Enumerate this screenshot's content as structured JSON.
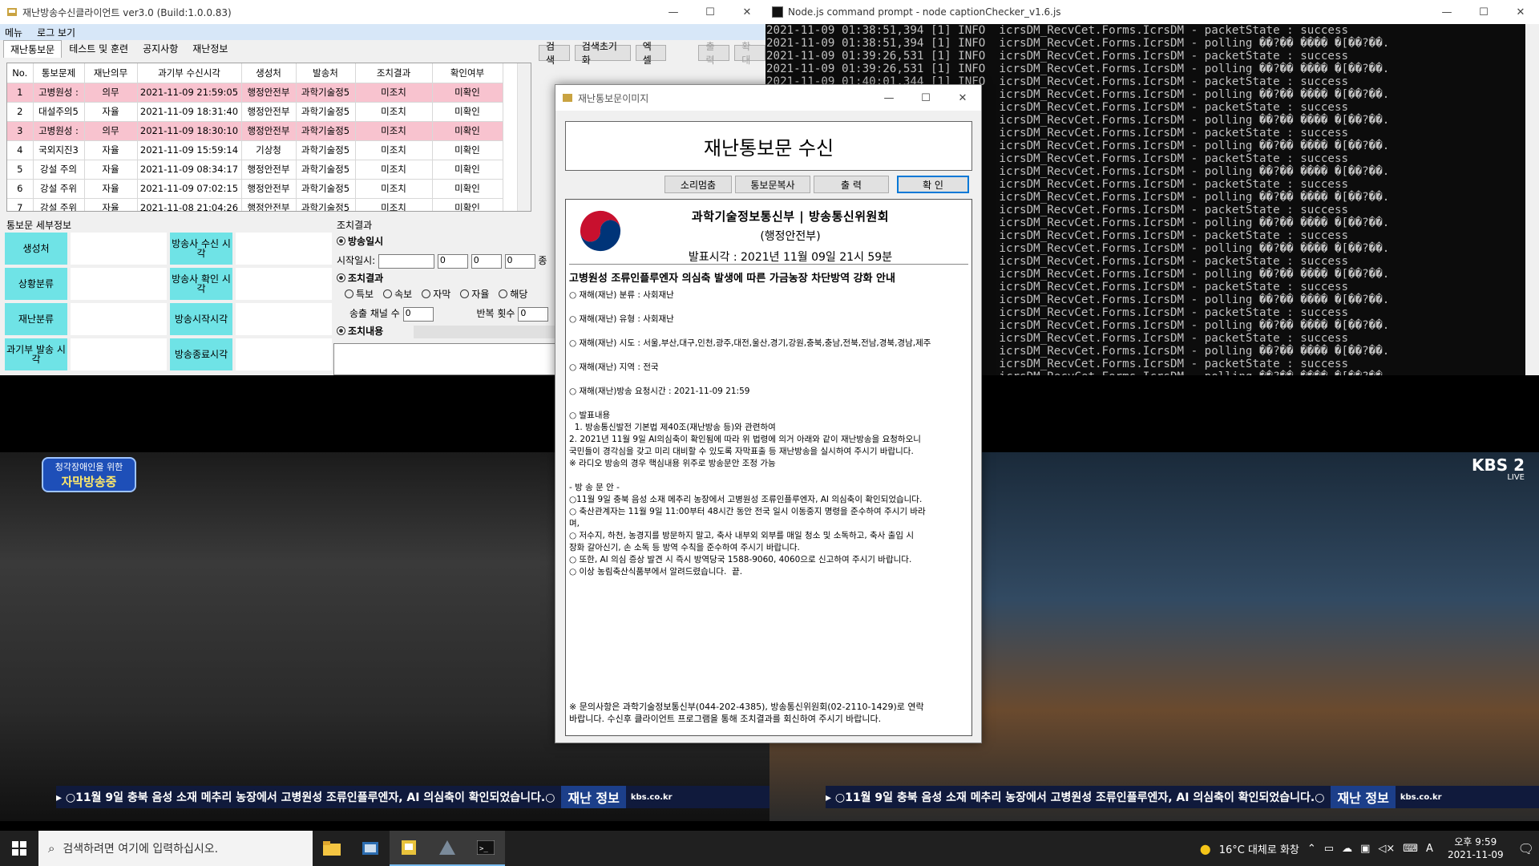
{
  "client": {
    "title": "재난방송수신클라이언트 ver3.0 (Build:1.0.0.83)",
    "menu": [
      "메뉴",
      "로그 보기"
    ],
    "tabs": [
      "재난통보문",
      "테스트 및 훈련",
      "공지사항",
      "재난정보"
    ],
    "buttons": {
      "search": "검색",
      "reset": "검색초기화",
      "excel": "엑셀",
      "print": "출력",
      "zoom": "확대"
    },
    "grid": {
      "headers": [
        "No.",
        "통보문제",
        "재난의무",
        "과기부 수신시각",
        "생성처",
        "발송처",
        "조치결과",
        "확인여부"
      ],
      "rows": [
        [
          "1",
          "고병원성 :",
          "의무",
          "2021-11-09 21:59:05",
          "행정안전부",
          "과학기술정5",
          "미조치",
          "미확인"
        ],
        [
          "2",
          "대설주의5",
          "자율",
          "2021-11-09 18:31:40",
          "행정안전부",
          "과학기술정5",
          "미조치",
          "미확인"
        ],
        [
          "3",
          "고병원성 :",
          "의무",
          "2021-11-09 18:30:10",
          "행정안전부",
          "과학기술정5",
          "미조치",
          "미확인"
        ],
        [
          "4",
          "국외지진3",
          "자율",
          "2021-11-09 15:59:14",
          "기상청",
          "과학기술정5",
          "미조치",
          "미확인"
        ],
        [
          "5",
          "강설 주의",
          "자율",
          "2021-11-09 08:34:17",
          "행정안전부",
          "과학기술정5",
          "미조치",
          "미확인"
        ],
        [
          "6",
          "강설 주위",
          "자율",
          "2021-11-09 07:02:15",
          "행정안전부",
          "과학기술정5",
          "미조치",
          "미확인"
        ],
        [
          "7",
          "강설 주위",
          "자율",
          "2021-11-08 21:04:26",
          "행정안전부",
          "과학기술정5",
          "미조치",
          "미확인"
        ]
      ]
    },
    "detail": {
      "section": "통보문 세부정보",
      "labels": [
        "생성처",
        "상황분류",
        "재난분류",
        "과기부 발송 시각",
        "방송사 수신 시각",
        "방송사 확인 시각",
        "방송시작시각",
        "방송종료시각"
      ]
    },
    "action": {
      "section": "조치결과",
      "broadcast_time": "방송일시",
      "start_label": "시작일시:",
      "spin_values": [
        "0",
        "0",
        "0"
      ],
      "tail": "종",
      "result_label": "조치결과",
      "radios": [
        "특보",
        "속보",
        "자막",
        "자율",
        "해당"
      ],
      "channels_label": "송출 채널 수",
      "channels_value": "0",
      "repeat_label": "반복 횟수",
      "repeat_value": "0",
      "content_label": "조치내용"
    }
  },
  "console": {
    "title": "Node.js command prompt - node  captionChecker_v1.6.js",
    "lines": [
      "2021-11-09 01:38:51,394 [1] INFO  icrsDM_RecvCet.Forms.IcrsDM - packetState : success",
      "2021-11-09 01:38:51,394 [1] INFO  icrsDM_RecvCet.Forms.IcrsDM - polling ��?�� ���� �[��?��.",
      "2021-11-09 01:39:26,531 [1] INFO  icrsDM_RecvCet.Forms.IcrsDM - packetState : success",
      "2021-11-09 01:39:26,531 [1] INFO  icrsDM_RecvCet.Forms.IcrsDM - polling ��?�� ���� �[��?��.",
      "2021-11-09 01:40:01,344 [1] INFO  icrsDM_RecvCet.Forms.IcrsDM - packetState : success",
      "                                  icrsDM_RecvCet.Forms.IcrsDM - polling ��?�� ���� �[��?��.",
      "                                  icrsDM_RecvCet.Forms.IcrsDM - packetState : success",
      "                                  icrsDM_RecvCet.Forms.IcrsDM - polling ��?�� ���� �[��?��.",
      "                                  icrsDM_RecvCet.Forms.IcrsDM - packetState : success",
      "                                  icrsDM_RecvCet.Forms.IcrsDM - polling ��?�� ���� �[��?��.",
      "                                  icrsDM_RecvCet.Forms.IcrsDM - packetState : success",
      "                                  icrsDM_RecvCet.Forms.IcrsDM - polling ��?�� ���� �[��?��.",
      "                                  icrsDM_RecvCet.Forms.IcrsDM - packetState : success",
      "                                  icrsDM_RecvCet.Forms.IcrsDM - polling ��?�� ���� �[��?��.",
      "                                  icrsDM_RecvCet.Forms.IcrsDM - packetState : success",
      "                                  icrsDM_RecvCet.Forms.IcrsDM - polling ��?�� ���� �[��?��.",
      "                                  icrsDM_RecvCet.Forms.IcrsDM - packetState : success",
      "                                  icrsDM_RecvCet.Forms.IcrsDM - polling ��?�� ���� �[��?��.",
      "                                  icrsDM_RecvCet.Forms.IcrsDM - packetState : success",
      "                                  icrsDM_RecvCet.Forms.IcrsDM - polling ��?�� ���� �[��?��.",
      "                                  icrsDM_RecvCet.Forms.IcrsDM - packetState : success",
      "                                  icrsDM_RecvCet.Forms.IcrsDM - polling ��?�� ���� �[��?��.",
      "                                  icrsDM_RecvCet.Forms.IcrsDM - packetState : success",
      "                                  icrsDM_RecvCet.Forms.IcrsDM - polling ��?�� ���� �[��?��.",
      "                                  icrsDM_RecvCet.Forms.IcrsDM - packetState : success",
      "                                  icrsDM_RecvCet.Forms.IcrsDM - polling ��?�� ���� �[��?��.",
      "                                  icrsDM_RecvCet.Forms.IcrsDM - packetState : success",
      "                                  icrsDM_RecvCet.Forms.IcrsDM - polling ��?�� ���� �[��?��."
    ]
  },
  "tv": {
    "left_badge_line1": "청각장애인을 위한",
    "left_badge_line2": "자막방송중",
    "ticker": "▸ ○11월 9일 충북 음성 소재 메추리 농장에서 고병원성 조류인플루엔자, AI 의심축이 확인되었습니다.○",
    "ticker_badge": "재난 정보",
    "ticker_site": "kbs.co.kr",
    "kbs_logo": "KBS 2",
    "kbs_live": "LIVE"
  },
  "popup": {
    "title": "재난통보문이미지",
    "header": "재난통보문 수신",
    "buttons": [
      "소리멈춤",
      "통보문복사",
      "출  력",
      "확  인"
    ],
    "org_line1": "과학기술정보통신부 | 방송통신위원회",
    "org_line2": "(행정안전부)",
    "announce": "발표시각 : 2021년 11월 09일 21시 59분",
    "msg_title": "고병원성 조류인플루엔자 의심축 발생에 따른 가금농장 차단방역 강화 안내",
    "body": [
      "○ 재해(재난) 분류 : 사회재난",
      "○ 재해(재난) 유형 : 사회재난",
      "○ 재해(재난) 시도 : 서울,부산,대구,인천,광주,대전,울산,경기,강원,충북,충남,전북,전남,경북,경남,제주",
      "○ 재해(재난) 지역 : 전국",
      "○ 재해(재난)방송 요청시간 : 2021-11-09 21:59",
      "○ 발표내용\n  1. 방송통신발전 기본법 제40조(재난방송 등)와 관련하여\n2. 2021년 11월 9일 AI의심축이 확인됨에 따라 위 법령에 의거 아래와 같이 재난방송을 요청하오니\n국민들이 경각심을 갖고 미리 대비할 수 있도록 자막표출 등 재난방송을 실시하여 주시기 바랍니다.\n※ 라디오 방송의 경우 핵심내용 위주로 방송문안 조정 가능",
      "- 방 송 문 안 -\n○11월 9일 충북 음성 소재 메추리 농장에서 고병원성 조류인플루엔자, AI 의심축이 확인되었습니다.\n○ 축산관계자는 11월 9일 11:00부터 48시간 동안 전국 일시 이동중지 명령을 준수하여 주시기 바라\n며,\n○ 저수지, 하천, 농경지를 방문하지 말고, 축사 내부외 외부를 매일 청소 및 소독하고, 축사 출입 시\n장화 갈아신기, 손 소독 등 방역 수칙을 준수하여 주시기 바랍니다.\n○ 또한, AI 의심 증상 발견 시 즉시 방역당국 1588-9060, 4060으로 신고하여 주시기 바랍니다.\n○ 이상 농림축산식품부에서 알려드렸습니다.  끝."
    ],
    "footnote": "※ 문의사항은 과학기술정보통신부(044-202-4385), 방송통신위원회(02-2110-1429)로 연락\n바랍니다. 수신후 클라이언트 프로그램을 통해 조치결과를 회신하여 주시기 바랍니다."
  },
  "taskbar": {
    "search_placeholder": "검색하려면 여기에 입력하십시오.",
    "weather": "16°C  대체로 화창",
    "ime": "A",
    "time": "오후 9:59",
    "date": "2021-11-09"
  },
  "colors": {
    "highlight_row": "#f8c3cf",
    "detail_cell": "#6fe3e6",
    "console_bg": "#0c0c0c",
    "ticker_bg": "#101a3c"
  }
}
